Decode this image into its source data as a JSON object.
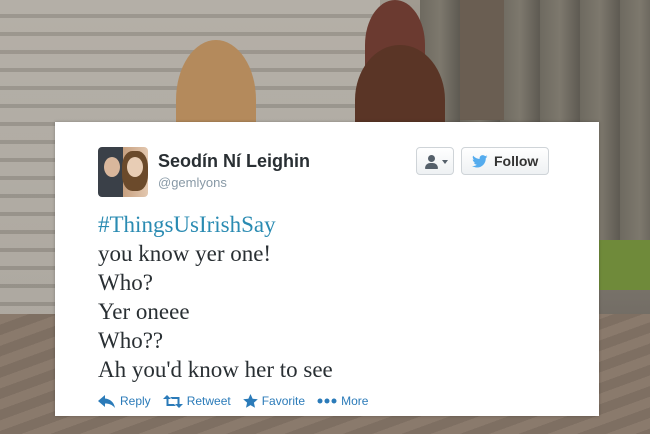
{
  "tweet_card": {
    "user": {
      "display_name": "Seodín Ní Leighin",
      "handle": "@gemlyons",
      "avatar_icon": "user-avatar-photo"
    },
    "buttons": {
      "user_actions_icon": "person-dropdown-icon",
      "follow_label": "Follow",
      "follow_icon": "twitter-bird-icon"
    },
    "text": {
      "hashtag": "#ThingsUsIrishSay",
      "lines": [
        "you know yer one!",
        "Who?",
        "Yer oneee",
        "Who??",
        "Ah you'd know her to see"
      ]
    },
    "actions": {
      "reply": "Reply",
      "retweet": "Retweet",
      "favorite": "Favorite",
      "more": "More"
    },
    "colors": {
      "link": "#2b7bb9",
      "hashtag": "#2a8bb2",
      "bird": "#55acee"
    }
  }
}
